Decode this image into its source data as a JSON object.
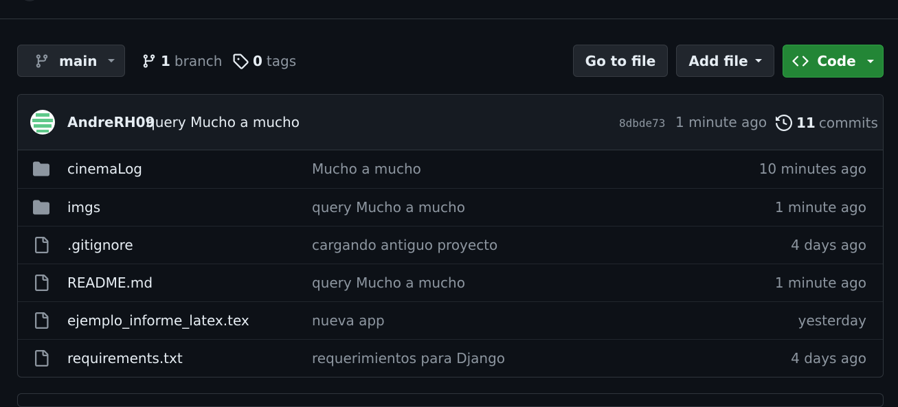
{
  "toolbar": {
    "branch_name": "main",
    "branch_count": "1",
    "branch_label": "branch",
    "tag_count": "0",
    "tag_label": "tags",
    "goto_label": "Go to file",
    "add_label": "Add file",
    "code_label": "Code"
  },
  "commit": {
    "author": "AndreRH09",
    "message": "query Mucho a mucho",
    "sha": "8dbde73",
    "age": "1 minute ago",
    "count": "11",
    "count_label": "commits"
  },
  "files": [
    {
      "type": "folder",
      "name": "cinemaLog",
      "message": "Mucho a mucho",
      "age": "10 minutes ago"
    },
    {
      "type": "folder",
      "name": "imgs",
      "message": "query Mucho a mucho",
      "age": "1 minute ago"
    },
    {
      "type": "file",
      "name": ".gitignore",
      "message": "cargando antiguo proyecto",
      "age": "4 days ago"
    },
    {
      "type": "file",
      "name": "README.md",
      "message": "query Mucho a mucho",
      "age": "1 minute ago"
    },
    {
      "type": "file",
      "name": "ejemplo_informe_latex.tex",
      "message": "nueva app",
      "age": "yesterday"
    },
    {
      "type": "file",
      "name": "requirements.txt",
      "message": "requerimientos para Django",
      "age": "4 days ago"
    }
  ],
  "colors": {
    "background": "#0d1117",
    "primary_button": "#238636",
    "muted_text": "#8d96a0"
  }
}
